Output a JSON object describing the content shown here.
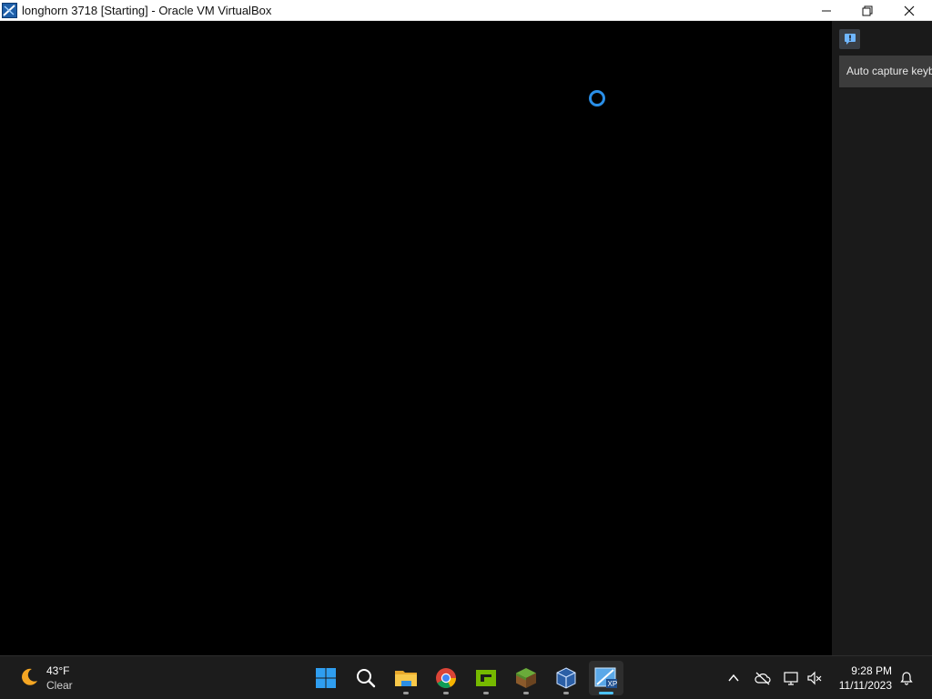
{
  "window": {
    "title": "longhorn 3718 [Starting] - Oracle VM VirtualBox",
    "minimize_glyph": "—",
    "restore_glyph": "❐",
    "close_glyph": "✕"
  },
  "vm": {
    "loading_icon": "busy-spinner-icon",
    "accent": "#2a8fe8"
  },
  "notification": {
    "icon": "chat-notification-icon",
    "text": "Auto capture keyboard"
  },
  "taskbar": {
    "weather": {
      "icon": "moon-icon",
      "temperature": "43°F",
      "condition": "Clear"
    },
    "apps": [
      {
        "name": "start",
        "icon": "windows-start-icon"
      },
      {
        "name": "search",
        "icon": "search-icon"
      },
      {
        "name": "file-explorer",
        "icon": "folder-icon"
      },
      {
        "name": "chrome",
        "icon": "chrome-icon"
      },
      {
        "name": "nvidia",
        "icon": "nvidia-icon"
      },
      {
        "name": "minecraft",
        "icon": "minecraft-grass-block-icon"
      },
      {
        "name": "virtualbox-manager",
        "icon": "virtualbox-cube-icon"
      },
      {
        "name": "virtualbox-vm",
        "icon": "virtualbox-vm-xp-icon",
        "active": true
      }
    ],
    "tray": [
      {
        "name": "show-hidden",
        "icon": "chevron-up-icon"
      },
      {
        "name": "onedrive",
        "icon": "cloud-offline-icon"
      },
      {
        "name": "network",
        "icon": "network-icon"
      },
      {
        "name": "volume",
        "icon": "speaker-muted-icon"
      }
    ],
    "clock": {
      "time": "9:28 PM",
      "date": "11/11/2023"
    },
    "notifications_icon": "bell-icon",
    "accent": "#4cc2ff"
  }
}
